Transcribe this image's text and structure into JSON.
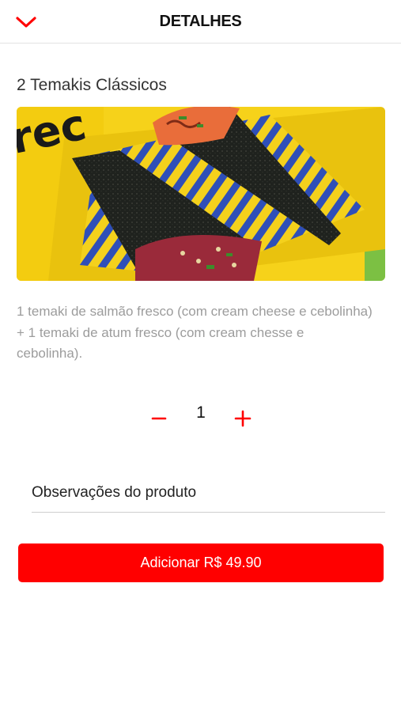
{
  "header": {
    "title": "DETALHES",
    "back_icon": "chevron-down-icon"
  },
  "product": {
    "name": "2 Temakis Clássicos",
    "description": "1 temaki de salmão fresco (com cream cheese e cebolinha) + 1 temaki de atum fresco (com cream chesse e cebolinha).",
    "image_logo_text": "rec"
  },
  "quantity": {
    "value": "1",
    "decrement_icon": "minus-icon",
    "increment_icon": "plus-icon"
  },
  "notes": {
    "placeholder": "Observações do produto",
    "value": ""
  },
  "add_button": {
    "label": "Adicionar R$ 49.90"
  },
  "colors": {
    "accent": "#ff0000",
    "description_text": "#9c9c9c",
    "image_tray": "#f6d21a",
    "image_stripes_blue": "#2f4fb8"
  }
}
